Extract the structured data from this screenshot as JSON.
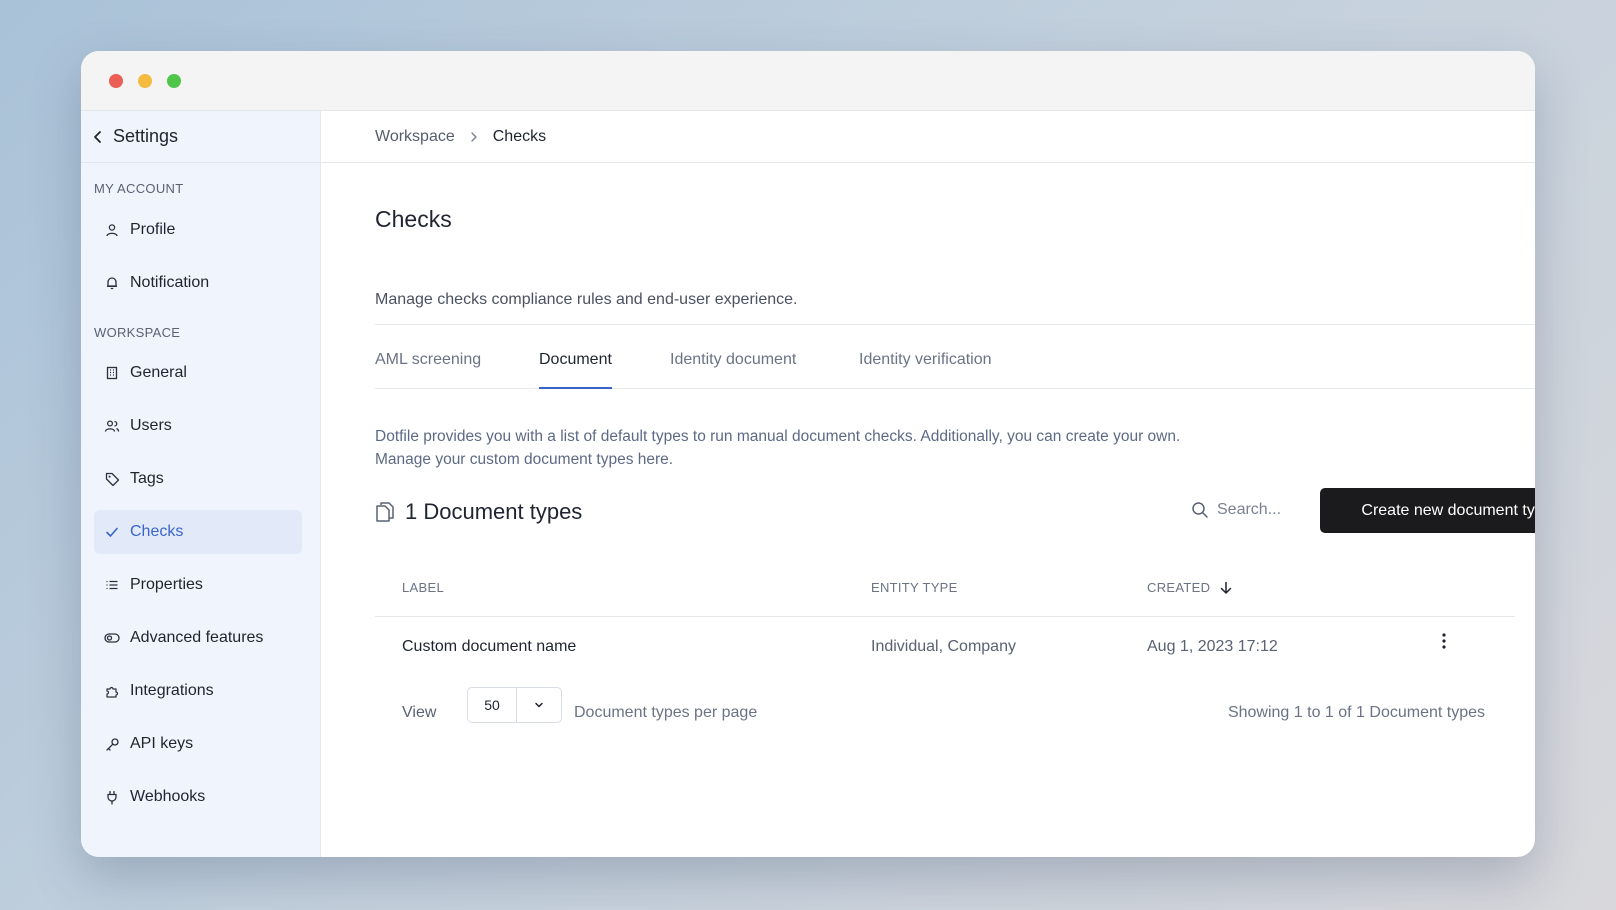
{
  "sidebar": {
    "header": "Settings",
    "sections": [
      {
        "label": "MY ACCOUNT"
      },
      {
        "label": "WORKSPACE"
      }
    ],
    "items": [
      {
        "label": "Profile",
        "icon": "user-icon"
      },
      {
        "label": "Notification",
        "icon": "bell-icon"
      },
      {
        "label": "General",
        "icon": "building-icon"
      },
      {
        "label": "Users",
        "icon": "users-icon"
      },
      {
        "label": "Tags",
        "icon": "tag-icon"
      },
      {
        "label": "Checks",
        "icon": "check-icon",
        "active": true
      },
      {
        "label": "Properties",
        "icon": "list-icon"
      },
      {
        "label": "Advanced features",
        "icon": "toggle-icon"
      },
      {
        "label": "Integrations",
        "icon": "puzzle-icon"
      },
      {
        "label": "API keys",
        "icon": "key-icon"
      },
      {
        "label": "Webhooks",
        "icon": "plug-icon"
      }
    ]
  },
  "breadcrumb": [
    "Workspace",
    "Checks"
  ],
  "page": {
    "title": "Checks",
    "description": "Manage checks compliance rules and end-user experience."
  },
  "tabs": [
    {
      "label": "AML screening"
    },
    {
      "label": "Document",
      "active": true
    },
    {
      "label": "Identity document"
    },
    {
      "label": "Identity verification"
    }
  ],
  "info": {
    "line1": "Dotfile provides you with a list of default types to run manual document checks. Additionally, you can create your own.",
    "line2": "Manage your custom document types here."
  },
  "list": {
    "title": "1 Document types",
    "search_placeholder": "Search...",
    "create_label": "Create new document type",
    "columns": [
      "LABEL",
      "ENTITY TYPE",
      "CREATED"
    ],
    "rows": [
      {
        "label": "Custom document name",
        "entity_type": "Individual, Company",
        "created": "Aug 1, 2023 17:12"
      }
    ]
  },
  "pager": {
    "view_label": "View",
    "per_page": "50",
    "per_page_label": "Document types per page",
    "showing": "Showing 1 to 1 of 1 Document types"
  },
  "colors": {
    "accent": "#3a64c8",
    "sidebar_bg": "#eff4fd",
    "primary_button": "#1b1b1d"
  }
}
